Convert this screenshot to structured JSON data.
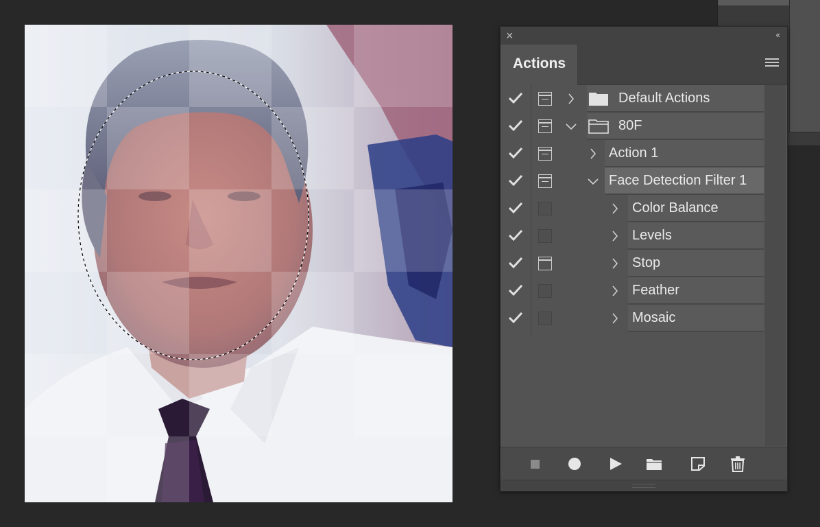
{
  "panel": {
    "tab_label": "Actions",
    "close_glyph": "×",
    "collapse_glyph": "‹‹"
  },
  "actions": [
    {
      "label": "Default Actions",
      "checked": true,
      "dialog": "on",
      "expanded": false,
      "type": "set",
      "indent": 0
    },
    {
      "label": "80F",
      "checked": true,
      "dialog": "on",
      "expanded": true,
      "type": "set",
      "indent": 0
    },
    {
      "label": "Action 1",
      "checked": true,
      "dialog": "on",
      "expanded": false,
      "type": "action",
      "indent": 1
    },
    {
      "label": "Face Detection Filter 1",
      "checked": true,
      "dialog": "on",
      "expanded": true,
      "type": "action",
      "indent": 1,
      "selected": true
    },
    {
      "label": "Color Balance",
      "checked": true,
      "dialog": "off",
      "expanded": false,
      "type": "step",
      "indent": 2
    },
    {
      "label": "Levels",
      "checked": true,
      "dialog": "off",
      "expanded": false,
      "type": "step",
      "indent": 2
    },
    {
      "label": "Stop",
      "checked": true,
      "dialog": "stop",
      "expanded": false,
      "type": "step",
      "indent": 2
    },
    {
      "label": "Feather",
      "checked": true,
      "dialog": "off",
      "expanded": false,
      "type": "step",
      "indent": 2
    },
    {
      "label": "Mosaic",
      "checked": true,
      "dialog": "off",
      "expanded": false,
      "type": "step",
      "indent": 2
    }
  ],
  "footer_icons": [
    "stop-icon",
    "record-icon",
    "play-icon",
    "folder-icon",
    "new-action-icon",
    "trash-icon"
  ],
  "colors": {
    "panel_bg": "#535353",
    "row_bg": "#5a5a5a",
    "selected_row_bg": "#686868",
    "text": "#eaeaea",
    "app_bg": "#282828"
  }
}
